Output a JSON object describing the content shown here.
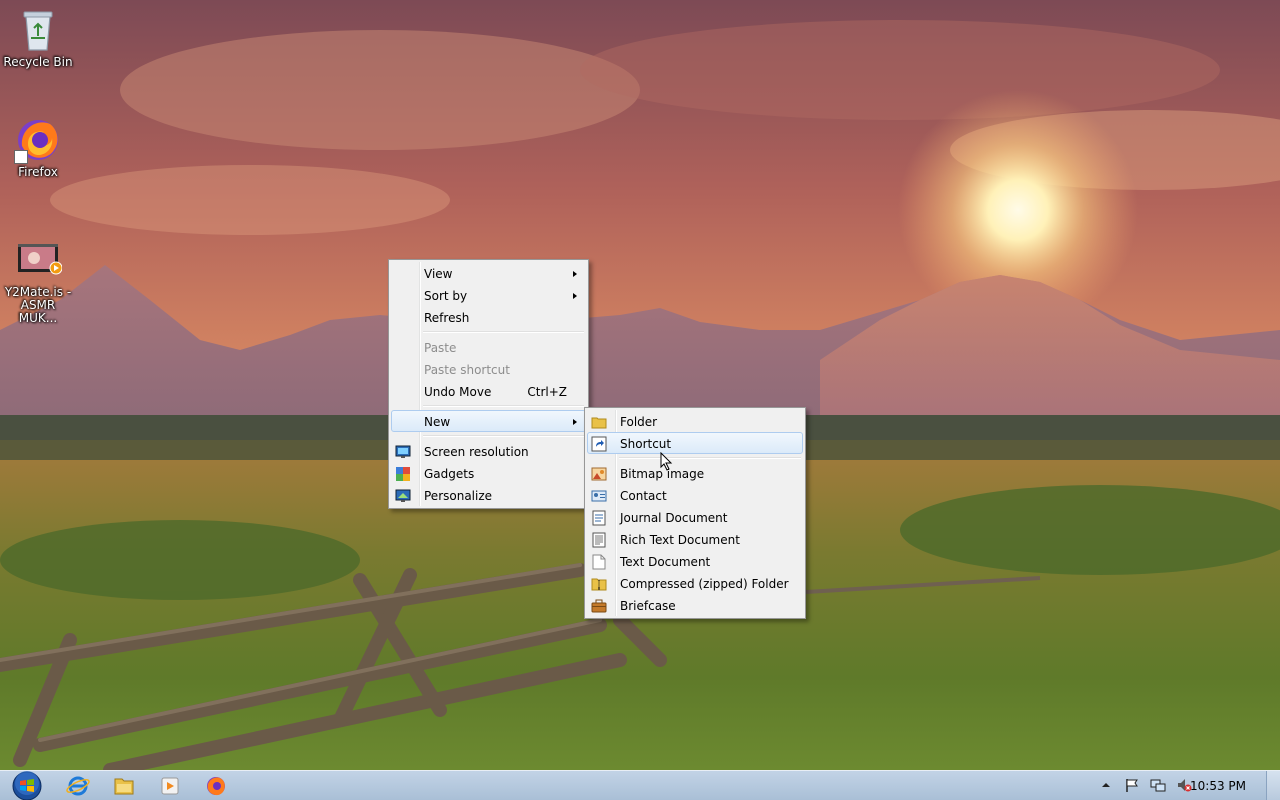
{
  "desktop": {
    "icons": [
      {
        "label": "Recycle Bin",
        "icon": "recycle-bin-icon"
      },
      {
        "label": "Firefox",
        "icon": "firefox-icon"
      },
      {
        "label": "Y2Mate.is - ASMR MUK...",
        "icon": "video-file-icon"
      }
    ]
  },
  "context_menu": {
    "items": [
      {
        "label": "View",
        "submenu": true
      },
      {
        "label": "Sort by",
        "submenu": true
      },
      {
        "label": "Refresh"
      },
      {
        "label": "Paste",
        "disabled": true
      },
      {
        "label": "Paste shortcut",
        "disabled": true
      },
      {
        "label": "Undo Move",
        "accelerator": "Ctrl+Z"
      },
      {
        "label": "New",
        "submenu": true,
        "active": true
      },
      {
        "label": "Screen resolution",
        "icon": "screen-resolution-icon"
      },
      {
        "label": "Gadgets",
        "icon": "gadgets-icon"
      },
      {
        "label": "Personalize",
        "icon": "personalize-icon"
      }
    ]
  },
  "new_submenu": {
    "items": [
      {
        "label": "Folder",
        "icon": "folder-icon"
      },
      {
        "label": "Shortcut",
        "icon": "shortcut-icon",
        "hover": true
      },
      {
        "label": "Bitmap image",
        "icon": "bitmap-icon"
      },
      {
        "label": "Contact",
        "icon": "contact-icon"
      },
      {
        "label": "Journal Document",
        "icon": "journal-icon"
      },
      {
        "label": "Rich Text Document",
        "icon": "rich-text-icon"
      },
      {
        "label": "Text Document",
        "icon": "text-document-icon"
      },
      {
        "label": "Compressed (zipped) Folder",
        "icon": "zip-folder-icon"
      },
      {
        "label": "Briefcase",
        "icon": "briefcase-icon"
      }
    ]
  },
  "taskbar": {
    "pinned": [
      "internet-explorer-icon",
      "explorer-icon",
      "media-player-icon",
      "firefox-icon"
    ],
    "tray": [
      "show-hidden-icons-icon",
      "action-center-icon",
      "network-icon",
      "volume-muted-icon"
    ],
    "clock": "10:53 PM"
  }
}
